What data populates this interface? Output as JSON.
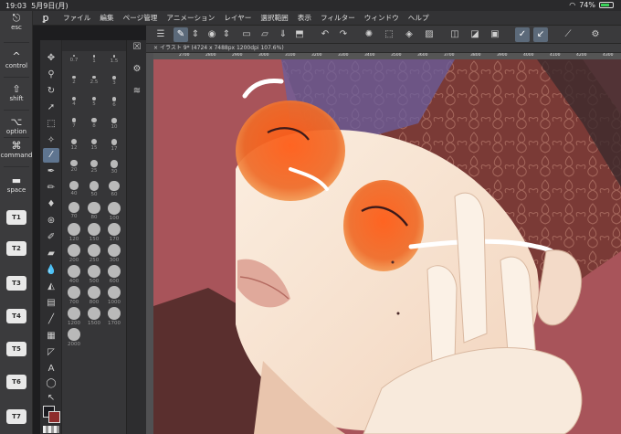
{
  "status": {
    "time": "19:03",
    "date": "5月9日(月)",
    "battery": "74%",
    "battery_level": 0.74
  },
  "modifiers": {
    "esc": "esc",
    "control": "control",
    "shift": "shift",
    "option": "option",
    "command": "command",
    "space": "space",
    "t_keys": [
      "T1",
      "T2",
      "T3",
      "T4",
      "T5",
      "T6",
      "T7"
    ]
  },
  "menu": [
    "ファイル",
    "編集",
    "ページ管理",
    "アニメーション",
    "レイヤー",
    "選択範囲",
    "表示",
    "フィルター",
    "ウィンドウ",
    "ヘルプ"
  ],
  "document": {
    "tab_title": "イラスト 9* (4724 x 7488px 1200dpi 107.6%)"
  },
  "ruler_ticks": [
    "2700",
    "2800",
    "2900",
    "3000",
    "3100",
    "3200",
    "3300",
    "3400",
    "3500",
    "3600",
    "3700",
    "3800",
    "3900",
    "4000",
    "4100",
    "4200",
    "4300"
  ],
  "brush_sizes": [
    "0.7",
    "1",
    "1.5",
    "2",
    "2.5",
    "3",
    "4",
    "5",
    "6",
    "7",
    "8",
    "10",
    "12",
    "15",
    "17",
    "20",
    "25",
    "30",
    "40",
    "50",
    "60",
    "70",
    "80",
    "100",
    "120",
    "150",
    "170",
    "200",
    "250",
    "300",
    "400",
    "500",
    "600",
    "700",
    "800",
    "1000",
    "1200",
    "1500",
    "1700",
    "2000"
  ],
  "colors": {
    "main": "#1b1b20",
    "sub": "#8e2c2c",
    "canvas_bg": "#a8545a",
    "lens": "#ff6a1a"
  }
}
